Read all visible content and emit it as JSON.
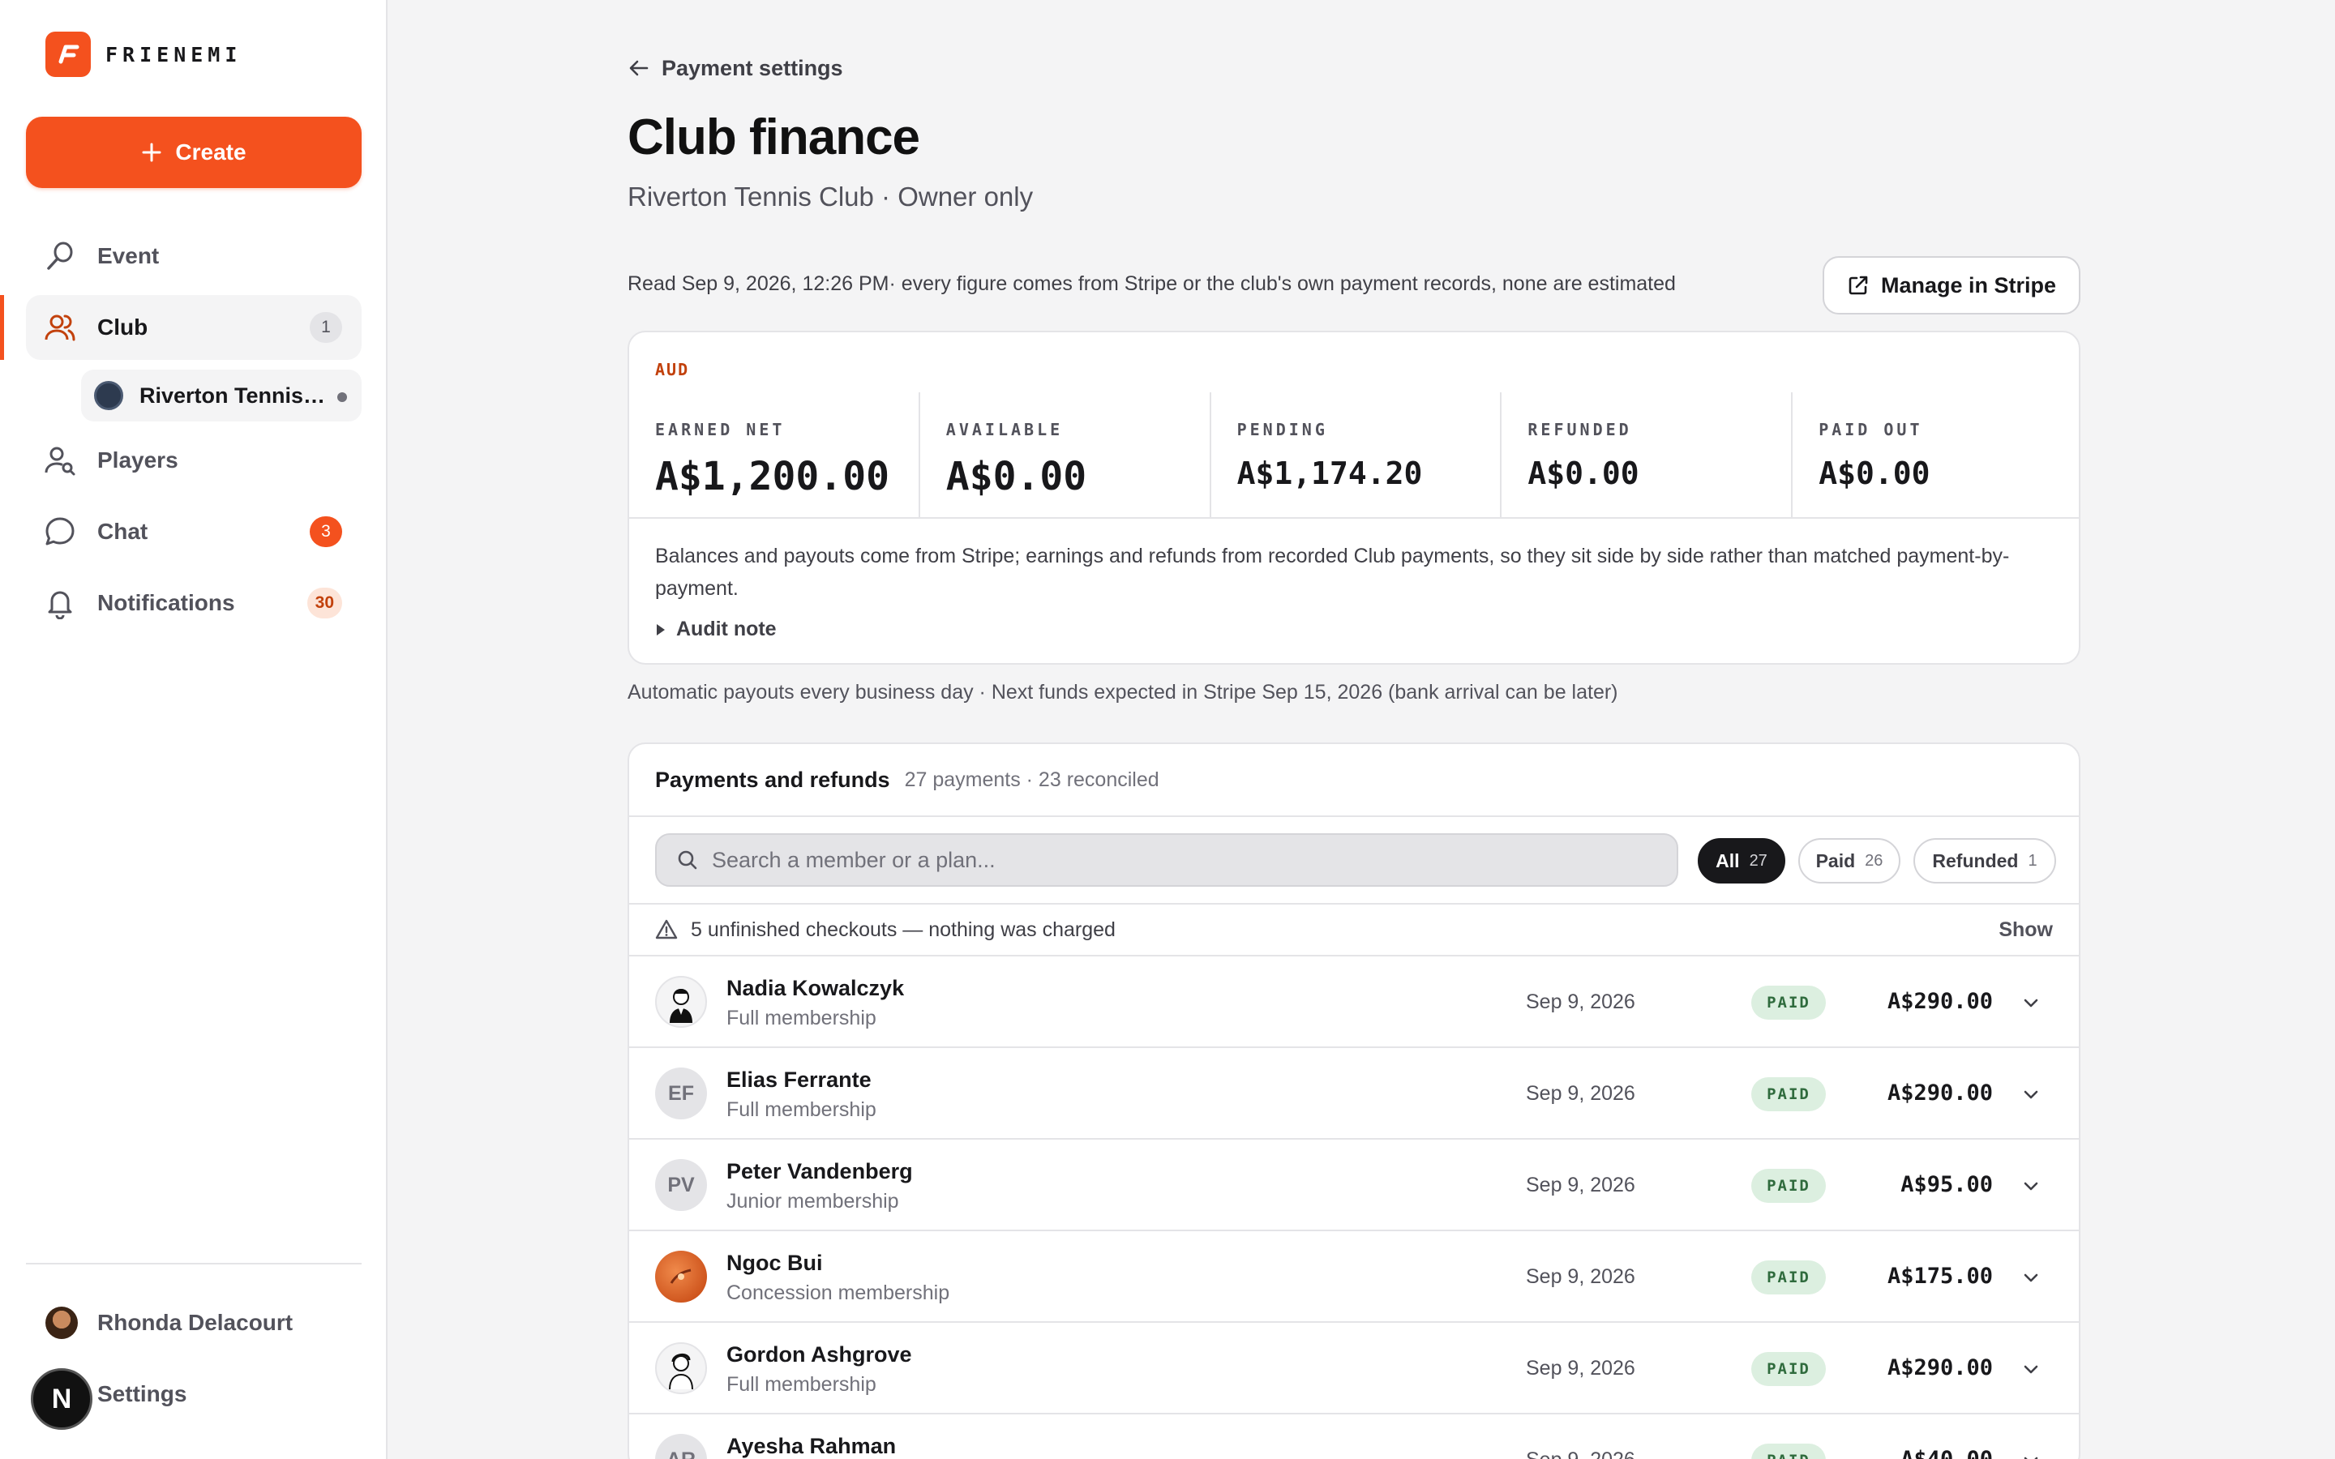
{
  "brand": {
    "name": "FRIENEMI"
  },
  "sidebar": {
    "create_label": "Create",
    "items": [
      {
        "label": "Event",
        "icon": "racket-icon"
      },
      {
        "label": "Club",
        "icon": "users-icon",
        "badge": "1"
      },
      {
        "label": "Players",
        "icon": "user-search-icon"
      },
      {
        "label": "Chat",
        "icon": "chat-bubble-icon",
        "badge": "3"
      },
      {
        "label": "Notifications",
        "icon": "bell-icon",
        "badge": "30"
      }
    ],
    "sub_item": {
      "label": "Riverton Tennis Club"
    },
    "profile_name": "Rhonda Delacourt",
    "settings_label": "Settings",
    "dev_badge": "N"
  },
  "header": {
    "back_label": "Payment settings",
    "title": "Club finance",
    "subtitle": "Riverton Tennis Club · Owner only",
    "read_note": "Read Sep 9, 2026, 12:26 PM· every figure comes from Stripe or the club's own payment records, none are estimated",
    "stripe_button": "Manage in Stripe"
  },
  "summary": {
    "currency": "AUD",
    "stats": [
      {
        "label": "EARNED NET",
        "value": "A$1,200.00"
      },
      {
        "label": "AVAILABLE",
        "value": "A$0.00"
      },
      {
        "label": "PENDING",
        "value": "A$1,174.20"
      },
      {
        "label": "REFUNDED",
        "value": "A$0.00"
      },
      {
        "label": "PAID OUT",
        "value": "A$0.00"
      }
    ],
    "note": "Balances and payouts come from Stripe; earnings and refunds from recorded Club payments, so they sit side by side rather than matched payment-by-payment.",
    "audit_label": "Audit note",
    "payout_note": "Automatic payouts every business day · Next funds expected in Stripe Sep 15, 2026 (bank arrival can be later)"
  },
  "payments": {
    "title": "Payments and refunds",
    "count": "27 payments · 23 reconciled",
    "search_placeholder": "Search a member or a plan...",
    "filters": [
      {
        "label": "All",
        "count": "27"
      },
      {
        "label": "Paid",
        "count": "26"
      },
      {
        "label": "Refunded",
        "count": "1"
      }
    ],
    "warning": "5 unfinished checkouts — nothing was charged",
    "warning_action": "Show",
    "rows": [
      {
        "initials": "",
        "name": "Nadia Kowalczyk",
        "plan": "Full membership",
        "date": "Sep 9, 2026",
        "status": "PAID",
        "amount": "A$290.00"
      },
      {
        "initials": "EF",
        "name": "Elias Ferrante",
        "plan": "Full membership",
        "date": "Sep 9, 2026",
        "status": "PAID",
        "amount": "A$290.00"
      },
      {
        "initials": "PV",
        "name": "Peter Vandenberg",
        "plan": "Junior membership",
        "date": "Sep 9, 2026",
        "status": "PAID",
        "amount": "A$95.00"
      },
      {
        "initials": "",
        "name": "Ngoc Bui",
        "plan": "Concession membership",
        "date": "Sep 9, 2026",
        "status": "PAID",
        "amount": "A$175.00"
      },
      {
        "initials": "",
        "name": "Gordon Ashgrove",
        "plan": "Full membership",
        "date": "Sep 9, 2026",
        "status": "PAID",
        "amount": "A$290.00"
      },
      {
        "initials": "AR",
        "name": "Ayesha Rahman",
        "plan": "",
        "date": "Sep 9, 2026",
        "status": "PAID",
        "amount": "A$40.00"
      }
    ]
  },
  "colors": {
    "accent": "#f4511e",
    "paid_bg": "#dcefe0",
    "paid_text": "#2f6b3d"
  }
}
